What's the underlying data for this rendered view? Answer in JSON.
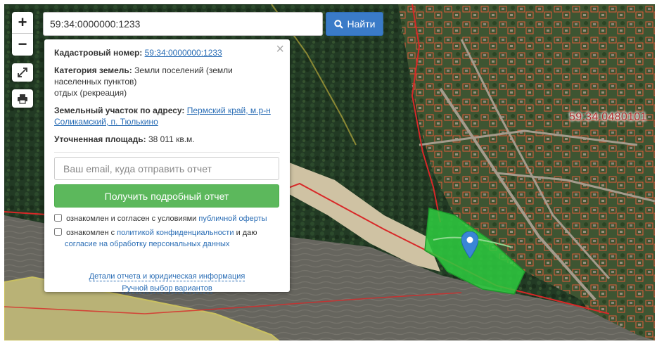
{
  "search": {
    "value": "59:34:0000000:1233",
    "button_label": "Найти"
  },
  "controls": {
    "zoom_in": "+",
    "zoom_out": "−"
  },
  "panel": {
    "cad_label": "Кадастровый номер:",
    "cad_value": "59:34:0000000:1233",
    "cat_label": "Категория земель:",
    "cat_value": "Земли поселений (земли населенных пунктов)",
    "cat_value2": "отдых (рекреация)",
    "addr_label": "Земельный участок по адресу:",
    "addr_value": "Пермский край, м.р-н Соликамский, п. Тюлькино",
    "area_label": "Уточненная площадь:",
    "area_value": "38 011 кв.м.",
    "email_placeholder": "Ваш email, куда отправить отчет",
    "report_button": "Получить подробный отчет",
    "consent1_text": "ознакомлен и согласен с условиями",
    "consent1_link": "публичной оферты",
    "consent2_text": "ознакомлен с",
    "consent2_link": "политикой конфиденциальности",
    "consent2_mid": "и даю",
    "consent2_link2": "согласие на обработку персональных данных",
    "details_link": "Детали отчета и юридическая информация",
    "manual_link": "Ручной выбор вариантов"
  },
  "map": {
    "block_label": "59:34:0480101",
    "colors": {
      "parcel_fill": "#2ecc40",
      "parcel_border": "#e05a3a",
      "boundary": "#d82828",
      "river": "#6b6a63",
      "forest": "#1f3320",
      "marker": "#3a86d6"
    }
  }
}
